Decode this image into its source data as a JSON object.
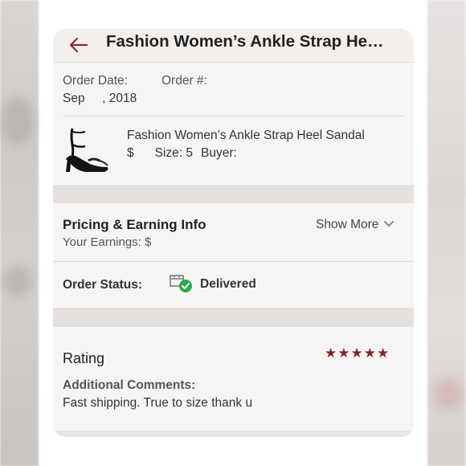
{
  "header": {
    "title": "Fashion Women’s Ankle Strap He…",
    "back_icon": "back-arrow-icon",
    "accent_color": "#8a2b36"
  },
  "order": {
    "date_label": "Order Date:",
    "number_label": "Order #:",
    "date_value": "Sep     , 2018"
  },
  "product": {
    "name": "Fashion Women’s Ankle Strap Heel Sandal",
    "price": "$",
    "size": "Size: 5",
    "buyer": "Buyer:",
    "image_icon": "black-heel-sandal-image"
  },
  "pricing": {
    "title": "Pricing & Earning Info",
    "earnings": "Your Earnings: $",
    "show_more": "Show More"
  },
  "status": {
    "label": "Order Status:",
    "value": "Delivered",
    "icon": "delivered-box-check-icon",
    "icon_color": "#2fa84f"
  },
  "rating": {
    "label": "Rating",
    "stars": 5,
    "star_color": "#7b2a33",
    "comments_label": "Additional Comments:",
    "comments": "Fast shipping. True to size thank u"
  }
}
